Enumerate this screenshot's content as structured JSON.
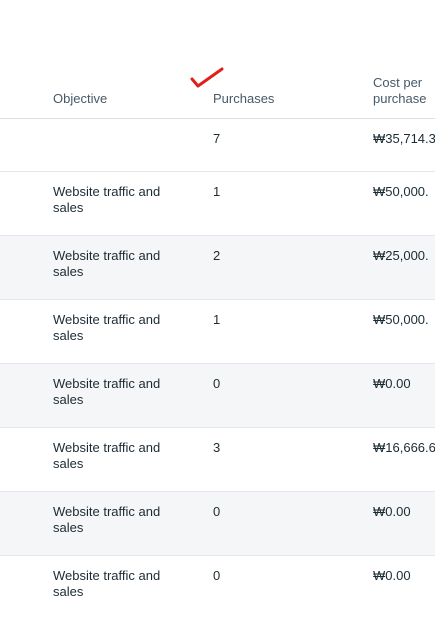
{
  "columns": {
    "objective": "Objective",
    "purchases": "Purchases",
    "cost_per_purchase": "Cost per purchase"
  },
  "annotation": {
    "icon": "red-checkmark-icon",
    "color": "#e0201b"
  },
  "summary": {
    "objective": "",
    "purchases": "7",
    "cost_per_purchase": "₩35,714.3"
  },
  "rows": [
    {
      "objective": "Website traffic and sales",
      "purchases": "1",
      "cost_per_purchase": "₩50,000."
    },
    {
      "objective": "Website traffic and sales",
      "purchases": "2",
      "cost_per_purchase": "₩25,000."
    },
    {
      "objective": "Website traffic and sales",
      "purchases": "1",
      "cost_per_purchase": "₩50,000."
    },
    {
      "objective": "Website traffic and sales",
      "purchases": "0",
      "cost_per_purchase": "₩0.00"
    },
    {
      "objective": "Website traffic and sales",
      "purchases": "3",
      "cost_per_purchase": "₩16,666.6"
    },
    {
      "objective": "Website traffic and sales",
      "purchases": "0",
      "cost_per_purchase": "₩0.00"
    },
    {
      "objective": "Website traffic and sales",
      "purchases": "0",
      "cost_per_purchase": "₩0.00"
    }
  ]
}
